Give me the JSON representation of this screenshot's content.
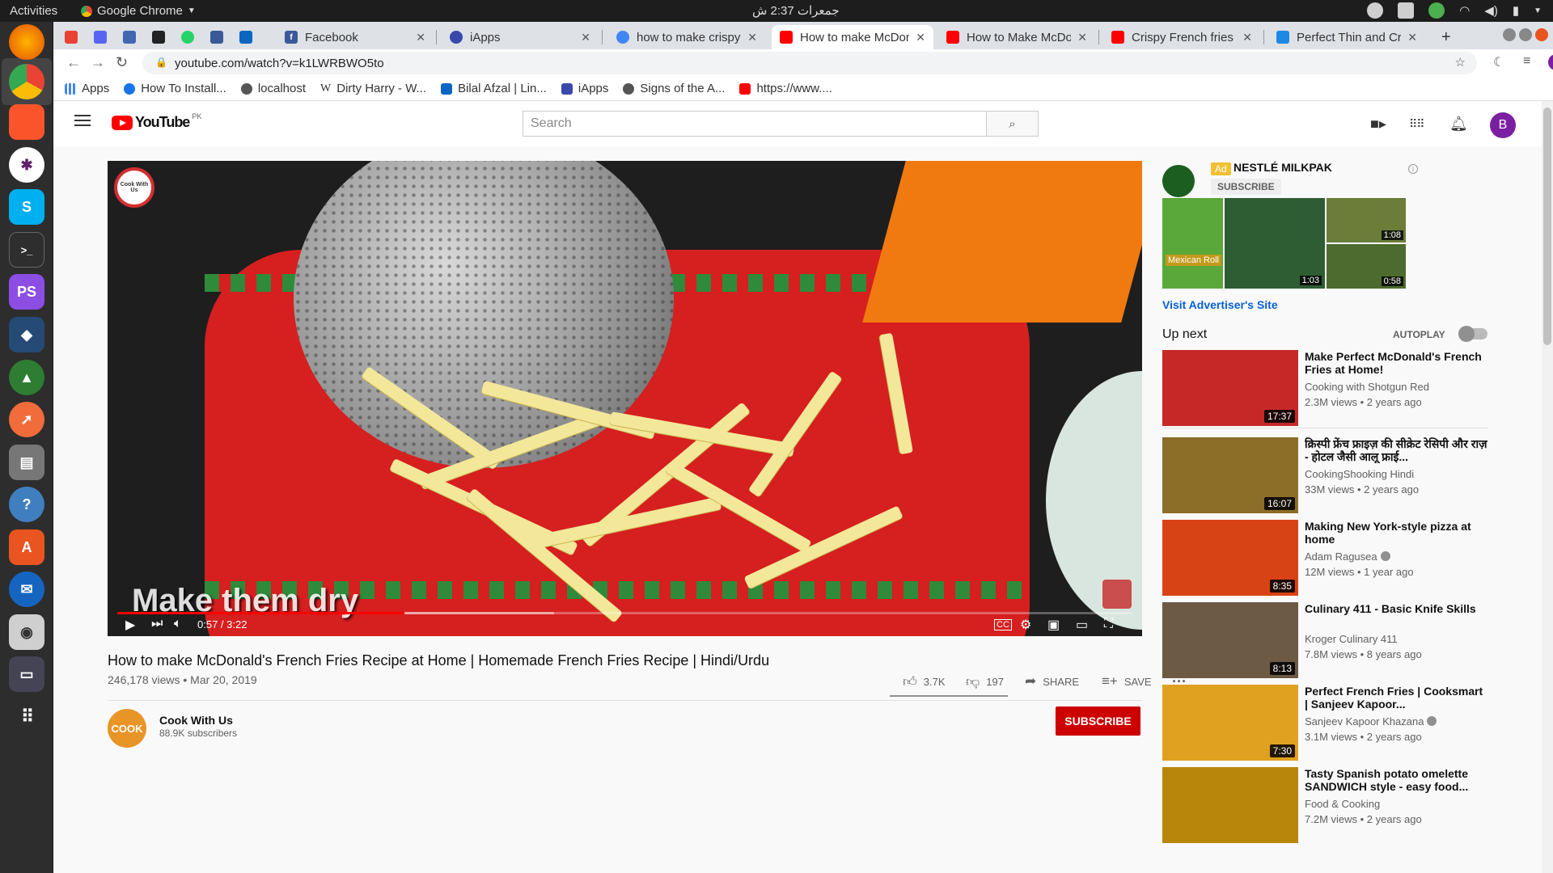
{
  "system": {
    "activities": "Activities",
    "app_menu": "Google Chrome",
    "clock": "جمعرات 2:37 ش"
  },
  "tabs": [
    {
      "title": "",
      "favicon": "gmail-icon",
      "color": "#ea4335"
    },
    {
      "title": "",
      "favicon": "discord-icon",
      "color": "#5865f2"
    },
    {
      "title": "",
      "favicon": "messenger-icon",
      "color": "#4267b2"
    },
    {
      "title": "",
      "favicon": "dev-icon",
      "color": "#222222"
    },
    {
      "title": "",
      "favicon": "whatsapp-icon",
      "color": "#25d366"
    },
    {
      "title": "",
      "favicon": "facebook-icon",
      "color": "#3b5998"
    },
    {
      "title": "",
      "favicon": "linkedin-icon",
      "color": "#0a66c2"
    },
    {
      "title": "Facebook",
      "favicon": "facebook-icon",
      "color": "#3b5998"
    },
    {
      "title": "iApps",
      "favicon": "iapps-icon",
      "color": "#3949ab"
    },
    {
      "title": "how to make crispy f",
      "favicon": "google-icon",
      "color": "#4285f4"
    },
    {
      "title": "How to make McDon",
      "favicon": "youtube-icon",
      "color": "#ff0000",
      "active": true
    },
    {
      "title": "How to Make McDon",
      "favicon": "youtube-icon",
      "color": "#ff0000"
    },
    {
      "title": "Crispy French fries R",
      "favicon": "youtube-icon",
      "color": "#ff0000"
    },
    {
      "title": "Perfect Thin and Cris",
      "favicon": "site-icon",
      "color": "#1e88e5"
    }
  ],
  "address": {
    "url": "youtube.com/watch?v=k1LWRBWO5to"
  },
  "bookmarks": [
    {
      "label": "Apps",
      "icon": "apps-grid-icon",
      "color": "#4285f4"
    },
    {
      "label": "How To Install...",
      "icon": "site-icon",
      "color": "#1a73e8"
    },
    {
      "label": "localhost",
      "icon": "globe-icon",
      "color": "#555555"
    },
    {
      "label": "Dirty Harry - W...",
      "icon": "wikipedia-icon",
      "color": "#333333"
    },
    {
      "label": "Bilal Afzal | Lin...",
      "icon": "linkedin-icon",
      "color": "#0a66c2"
    },
    {
      "label": "iApps",
      "icon": "iapps-icon",
      "color": "#3949ab"
    },
    {
      "label": "Signs of the A...",
      "icon": "globe-icon",
      "color": "#555555"
    },
    {
      "label": "https://www....",
      "icon": "youtube-icon",
      "color": "#ff0000"
    }
  ],
  "youtube": {
    "logo_text": "YouTube",
    "country": "PK",
    "search_placeholder": "Search",
    "avatar_letter": "B"
  },
  "video": {
    "overlay_text": "Make them dry",
    "badge_text": "Cook With Us",
    "time": "0:57 / 3:22",
    "progress": 0.283,
    "buffered": 0.43,
    "title": "How to make McDonald's French Fries Recipe at Home | Homemade French Fries Recipe | Hindi/Urdu",
    "views_date": "246,178 views • Mar 20, 2019",
    "likes": "3.7K",
    "dislikes": "197",
    "share": "SHARE",
    "save": "SAVE",
    "channel": {
      "name": "Cook With Us",
      "subscribers": "88.9K subscribers",
      "avatar_text": "COOK",
      "subscribe": "SUBSCRIBE"
    }
  },
  "ad": {
    "tag": "Ad",
    "name": "NESTLÉ MILKPAK",
    "subscribe": "SUBSCRIBE",
    "thumb1_text": "Mexican Roll",
    "thumb2_dur": "1:03",
    "thumb3_dur": "1:08",
    "thumb4_dur": "0:58",
    "visit": "Visit Advertiser's Site"
  },
  "sidebar": {
    "up_next": "Up next",
    "autoplay": "AUTOPLAY",
    "items": [
      {
        "title": "Make Perfect McDonald's French Fries at Home!",
        "channel": "Cooking with Shotgun Red",
        "meta": "2.3M views • 2 years ago",
        "duration": "17:37",
        "thumb_color": "#c62828",
        "verified": false
      },
      {
        "title": "क्रिस्पी फ्रेंच फ्राइज़ की सीक्रेट रेसिपी और राज़ - होटल जैसी आलू फ्राई...",
        "channel": "CookingShooking Hindi",
        "meta": "33M views • 2 years ago",
        "duration": "16:07",
        "thumb_color": "#8d6e28",
        "verified": false
      },
      {
        "title": "Making New York-style pizza at home",
        "channel": "Adam Ragusea",
        "meta": "12M views • 1 year ago",
        "duration": "8:35",
        "thumb_color": "#d84315",
        "verified": true
      },
      {
        "title": "Culinary 411 - Basic Knife Skills",
        "channel": "Kroger Culinary 411",
        "meta": "7.8M views • 8 years ago",
        "duration": "8:13",
        "thumb_color": "#6d5a44",
        "verified": false
      },
      {
        "title": "Perfect French Fries | Cooksmart | Sanjeev Kapoor...",
        "channel": "Sanjeev Kapoor Khazana",
        "meta": "3.1M views • 2 years ago",
        "duration": "7:30",
        "thumb_color": "#e0a020",
        "verified": true
      },
      {
        "title": "Tasty Spanish potato omelette SANDWICH style - easy food...",
        "channel": "Food & Cooking",
        "meta": "7.2M views • 2 years ago",
        "duration": "",
        "thumb_color": "#b8860b",
        "verified": false
      }
    ]
  }
}
